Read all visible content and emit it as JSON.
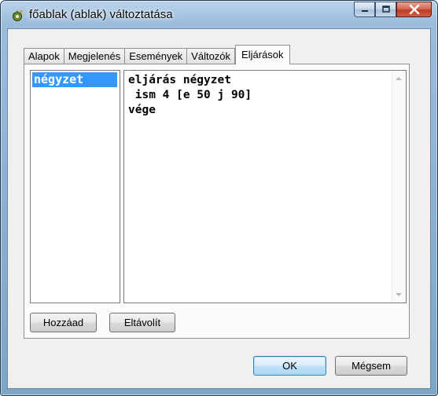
{
  "window": {
    "title": "főablak (ablak) változtatása",
    "icon": "gear-icon"
  },
  "tabs": [
    {
      "label": "Alapok",
      "active": false
    },
    {
      "label": "Megjelenés",
      "active": false
    },
    {
      "label": "Események",
      "active": false
    },
    {
      "label": "Változók",
      "active": false
    },
    {
      "label": "Eljárások",
      "active": true
    }
  ],
  "procedures": {
    "list": [
      "négyzet"
    ],
    "selected": "négyzet",
    "code": "eljárás négyzet\n ism 4 [e 50 j 90]\nvége"
  },
  "buttons": {
    "add": "Hozzáad",
    "remove": "Eltávolít",
    "ok": "OK",
    "cancel": "Mégsem"
  },
  "colors": {
    "selection": "#3399ff",
    "close_button": "#c7432a",
    "frame": "#9cbcdc"
  }
}
